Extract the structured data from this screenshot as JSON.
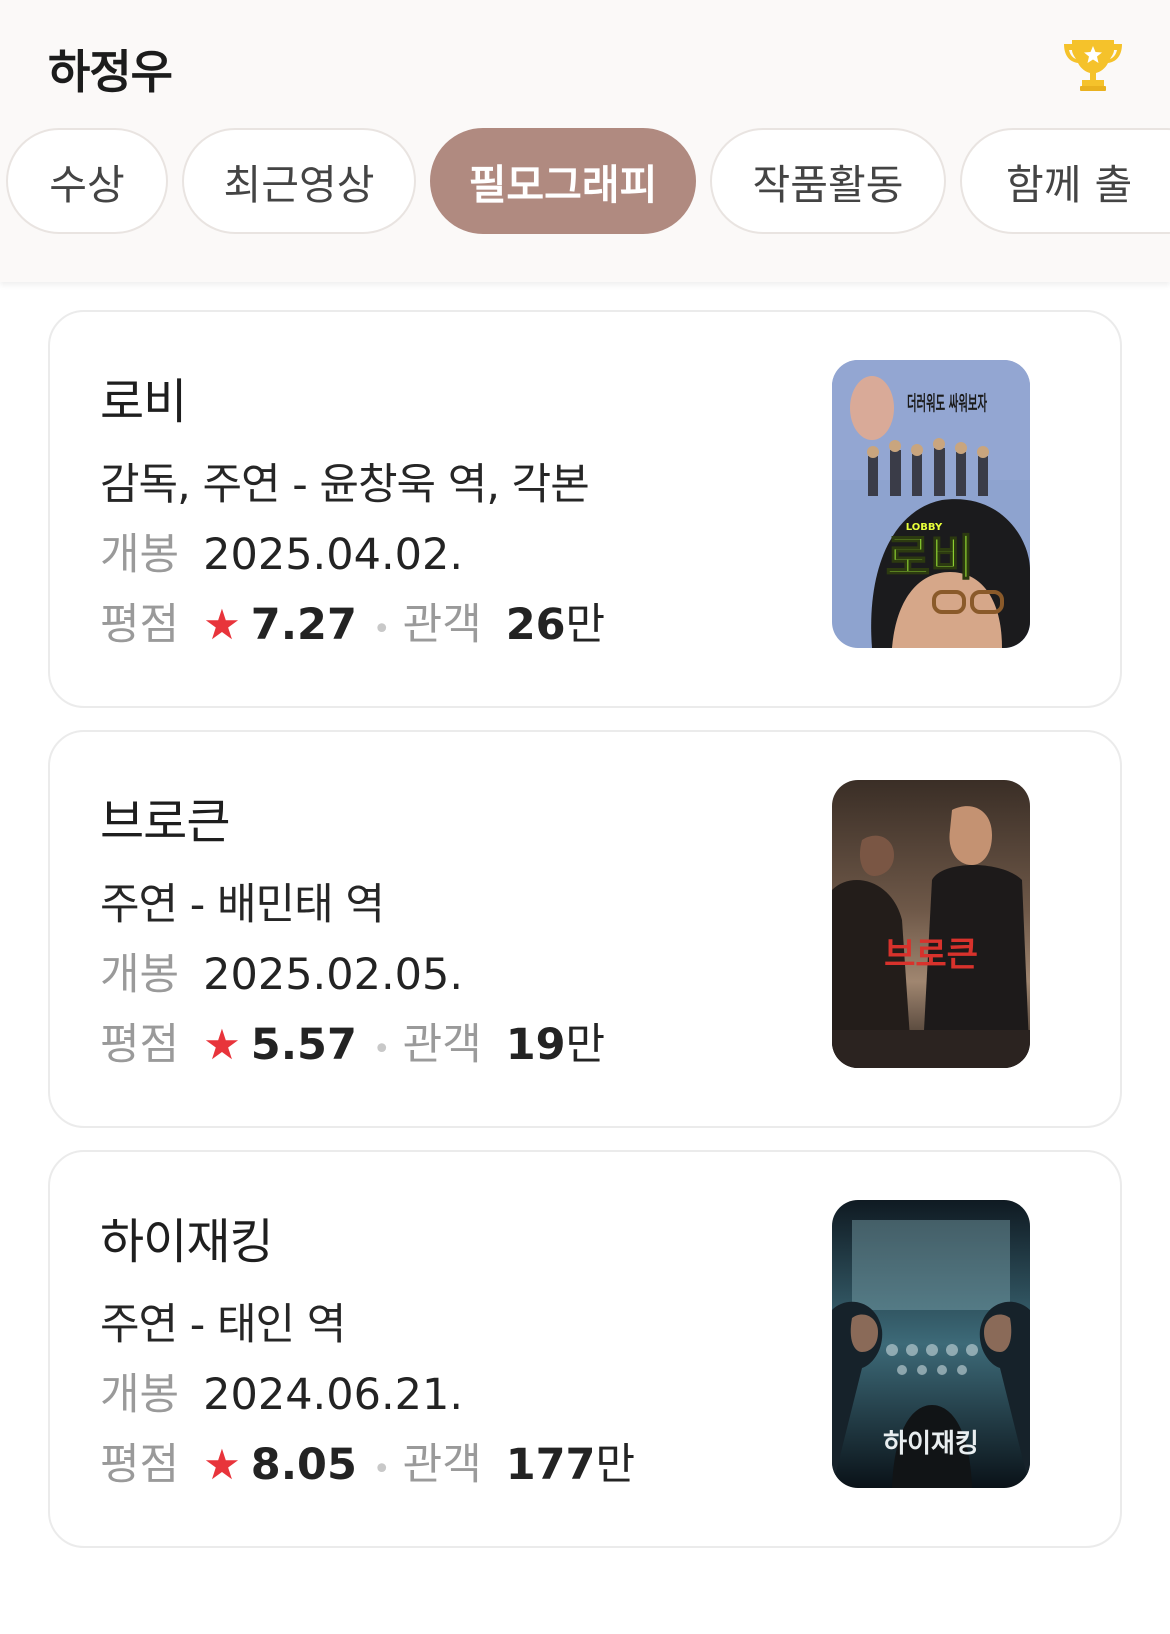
{
  "header": {
    "title": "하정우",
    "trophy_icon": "trophy-icon"
  },
  "tabs": [
    {
      "label": "수상",
      "active": false
    },
    {
      "label": "최근영상",
      "active": false
    },
    {
      "label": "필모그래피",
      "active": true
    },
    {
      "label": "작품활동",
      "active": false
    },
    {
      "label": "함께 출",
      "active": false
    }
  ],
  "filmography": [
    {
      "title": "로비",
      "role": "감독, 주연 - 윤창욱 역, 각본",
      "open_label": "개봉",
      "open_date": "2025.04.02.",
      "rating_label": "평점",
      "rating": "7.27",
      "audience_label": "관객",
      "audience_num": "26",
      "audience_unit": "만",
      "poster": {
        "top_text": "더러워도 싸워보자",
        "title_text": "로비",
        "small_text": "LOBBY"
      }
    },
    {
      "title": "브로큰",
      "role": "주연 - 배민태 역",
      "open_label": "개봉",
      "open_date": "2025.02.05.",
      "rating_label": "평점",
      "rating": "5.57",
      "audience_label": "관객",
      "audience_num": "19",
      "audience_unit": "만",
      "poster": {
        "title_text": "브로큰"
      }
    },
    {
      "title": "하이재킹",
      "role": "주연 - 태인 역",
      "open_label": "개봉",
      "open_date": "2024.06.21.",
      "rating_label": "평점",
      "rating": "8.05",
      "audience_label": "관객",
      "audience_num": "177",
      "audience_unit": "만",
      "poster": {
        "title_text": "하이재킹"
      }
    }
  ],
  "colors": {
    "active_tab": "#b08a80",
    "star": "#e8343b",
    "trophy": "#f5c22b"
  }
}
